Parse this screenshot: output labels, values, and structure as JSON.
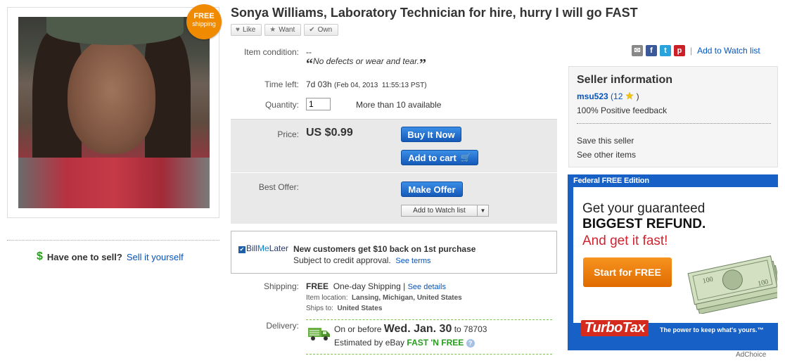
{
  "badge": {
    "line1": "FREE",
    "line2": "shipping"
  },
  "listing": {
    "title": "Sonya Williams, Laboratory Technician for hire, hurry I will go FAST"
  },
  "social": {
    "like": "Like",
    "want": "Want",
    "own": "Own"
  },
  "condition": {
    "label": "Item condition:",
    "value": "--",
    "quote": "No defects or wear and tear."
  },
  "time_left": {
    "label": "Time left:",
    "value": "7d 03h",
    "end": "(Feb 04, 2013  11:55:13 PST)"
  },
  "quantity": {
    "label": "Quantity:",
    "value": "1",
    "available": "More than 10 available"
  },
  "price": {
    "label": "Price:",
    "value": "US $0.99"
  },
  "buttons": {
    "buy_now": "Buy It Now",
    "add_to_cart": "Add to cart",
    "make_offer": "Make Offer",
    "add_watch": "Add to Watch list"
  },
  "best_offer": {
    "label": "Best Offer:"
  },
  "bml": {
    "brand_bill": "Bill",
    "brand_me": "Me",
    "brand_later": "Later",
    "headline": "New customers get $10 back on 1st purchase",
    "sub": "Subject to credit approval.",
    "link": "See terms"
  },
  "shipping": {
    "label": "Shipping:",
    "free": "FREE",
    "method": "One-day Shipping",
    "sep": "|",
    "link": "See details",
    "location_label": "Item location:",
    "location": "Lansing, Michigan, United States",
    "ships_label": "Ships to:",
    "ships_to": "United States"
  },
  "delivery": {
    "label": "Delivery:",
    "prefix": "On or before",
    "date": "Wed. Jan. 30",
    "to": "to 78703",
    "estimated": "Estimated by eBay",
    "fast_free": "FAST 'N FREE"
  },
  "sell": {
    "question": "Have one to sell?",
    "link": "Sell it yourself"
  },
  "share": {
    "sep": "|",
    "watch_link": "Add to Watch list"
  },
  "seller": {
    "title": "Seller information",
    "name": "msu523",
    "score_open": "(12",
    "score_close": ")",
    "feedback": "100% Positive feedback",
    "save": "Save this seller",
    "other": "See other items"
  },
  "ad": {
    "top": "Federal FREE Edition",
    "l1": "Get your guaranteed",
    "l2": "BIGGEST REFUND.",
    "l3": "And get it fast!",
    "btn": "Start for FREE",
    "intuit": "intuit",
    "turbotax": "TurboTax",
    "tagline": "The power to keep what's yours.™",
    "choice": "AdChoice"
  },
  "colors": {
    "link": "#0654ba",
    "button_blue": "#1559b9",
    "free_green": "#2a9d20",
    "badge_orange": "#f08a00",
    "ad_blue": "#1760c6"
  }
}
